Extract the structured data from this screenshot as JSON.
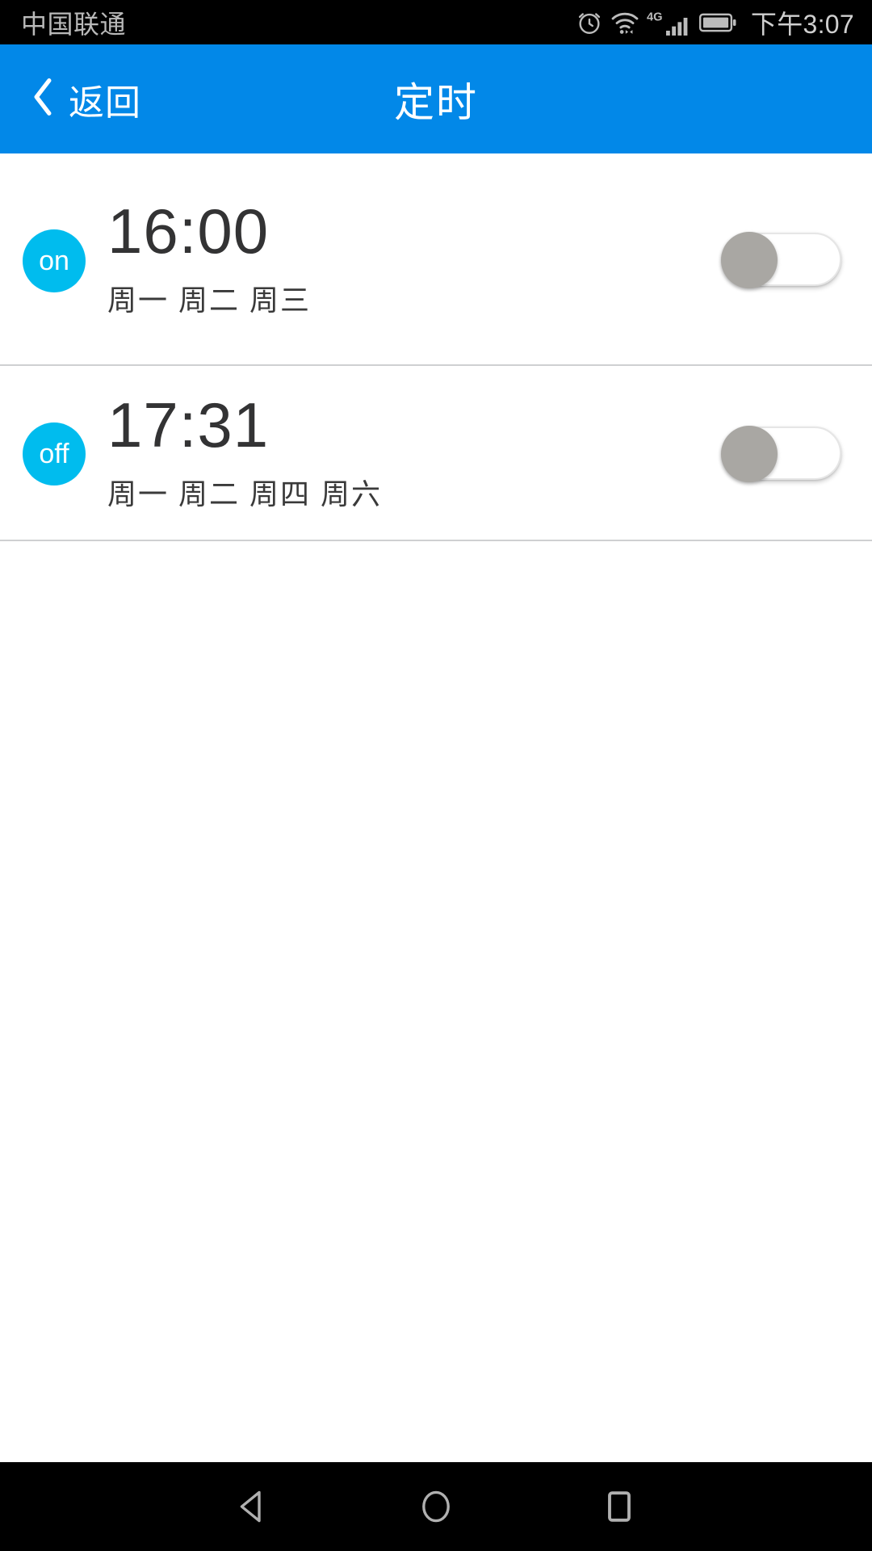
{
  "status_bar": {
    "carrier": "中国联通",
    "time": "下午3:07",
    "icons": [
      "alarm-clock-icon",
      "wifi-icon",
      "4g-icon",
      "signal-bars-icon",
      "battery-icon"
    ],
    "network_label": "4G",
    "background_color": "#000000",
    "text_color": "#b9b9b9"
  },
  "header": {
    "back_label": "返回",
    "title": "定时",
    "background_color": "#0288E8",
    "text_color": "#FFFFFF"
  },
  "timers": [
    {
      "state_label": "on",
      "time": "16:00",
      "days": "周一 周二 周三",
      "enabled": false,
      "badge_color": "#00BCEE"
    },
    {
      "state_label": "off",
      "time": "17:31",
      "days": "周一 周二 周四 周六",
      "enabled": false,
      "badge_color": "#00BCEE"
    }
  ],
  "nav_bar": {
    "back": "back-triangle-icon",
    "home": "home-circle-icon",
    "recents": "recents-square-icon",
    "background_color": "#000000"
  }
}
